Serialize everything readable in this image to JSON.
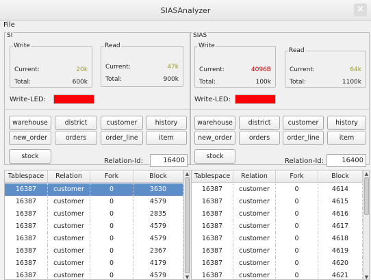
{
  "window": {
    "title": "SIASAnalyzer"
  },
  "menu": {
    "file": "File"
  },
  "si": {
    "label": "SI",
    "write": {
      "label": "Write",
      "current_label": "Current:",
      "current": "20k",
      "total_label": "Total:",
      "total": "600k"
    },
    "read": {
      "label": "Read",
      "current_label": "Current:",
      "current": "47k",
      "total_label": "Total:",
      "total": "900k"
    },
    "led_label": "Write-LED:",
    "buttons": [
      "warehouse",
      "district",
      "customer",
      "history",
      "new_order",
      "orders",
      "order_line",
      "item",
      "stock"
    ],
    "relation_id_label": "Relation-Id:",
    "relation_id": "16400",
    "table": {
      "headers": [
        "Tablespace",
        "Relation",
        "Fork",
        "Block"
      ],
      "rows": [
        [
          "16387",
          "customer",
          "0",
          "3630"
        ],
        [
          "16387",
          "customer",
          "0",
          "4579"
        ],
        [
          "16387",
          "customer",
          "0",
          "2835"
        ],
        [
          "16387",
          "customer",
          "0",
          "4579"
        ],
        [
          "16387",
          "customer",
          "0",
          "4579"
        ],
        [
          "16387",
          "customer",
          "0",
          "2367"
        ],
        [
          "16387",
          "customer",
          "0",
          "4179"
        ],
        [
          "16387",
          "customer",
          "0",
          "4579"
        ]
      ]
    }
  },
  "sias": {
    "label": "SIAS",
    "write": {
      "label": "Write",
      "current_label": "Current:",
      "current": "4096B",
      "total_label": "Total:",
      "total": "100k"
    },
    "read": {
      "label": "Read",
      "current_label": "Current:",
      "current": "64k",
      "total_label": "Total:",
      "total": "1100k"
    },
    "led_label": "Write-LED:",
    "buttons": [
      "warehouse",
      "district",
      "customer",
      "history",
      "new_order",
      "orders",
      "order_line",
      "item",
      "stock"
    ],
    "relation_id_label": "Relation-Id:",
    "relation_id": "16400",
    "table": {
      "headers": [
        "Tablespace",
        "Relation",
        "Fork",
        "Block"
      ],
      "rows": [
        [
          "16387",
          "customer",
          "0",
          "4614"
        ],
        [
          "16387",
          "customer",
          "0",
          "4615"
        ],
        [
          "16387",
          "customer",
          "0",
          "4616"
        ],
        [
          "16387",
          "customer",
          "0",
          "4617"
        ],
        [
          "16387",
          "customer",
          "0",
          "4618"
        ],
        [
          "16387",
          "customer",
          "0",
          "4619"
        ],
        [
          "16387",
          "customer",
          "0",
          "4620"
        ],
        [
          "16387",
          "customer",
          "0",
          "4621"
        ]
      ]
    }
  },
  "colors": {
    "led": "#ff0000",
    "selection": "#5e8ec8"
  }
}
